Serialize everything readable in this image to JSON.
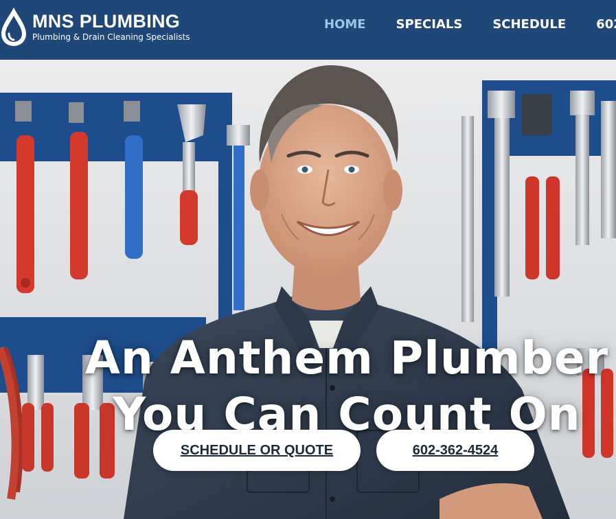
{
  "brand": {
    "name": "MNS PLUMBING",
    "tagline": "Plumbing & Drain Cleaning Specialists",
    "logo_icon": "water-drop-icon"
  },
  "nav": {
    "items": [
      {
        "label": "HOME",
        "active": true
      },
      {
        "label": "SPECIALS",
        "active": false
      },
      {
        "label": "SCHEDULE",
        "active": false
      },
      {
        "label": "602",
        "active": false
      }
    ]
  },
  "hero": {
    "headline_line1": "An Anthem Plumber",
    "headline_line2": "You Can Count On",
    "image": "smiling-plumber-with-tool-wall"
  },
  "cta": {
    "schedule_label": "SCHEDULE OR QUOTE",
    "phone_label": "602-362-4524"
  },
  "colors": {
    "header_bg": "#1f4878",
    "nav_active": "#9fc6ea",
    "nav_text": "#ffffff",
    "button_bg": "#ffffff",
    "button_text": "#1c2b3c"
  }
}
